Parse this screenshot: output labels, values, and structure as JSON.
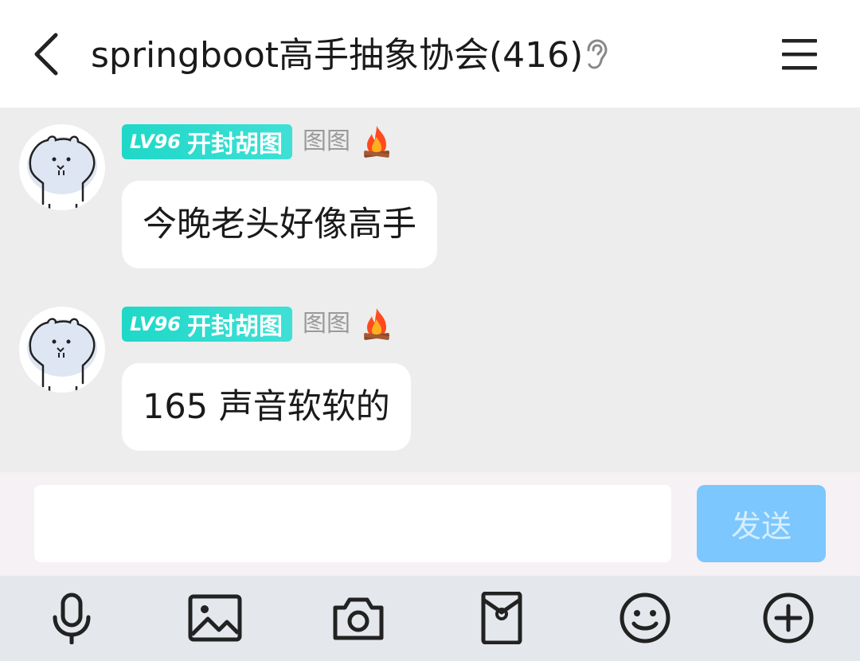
{
  "header": {
    "title": "springboot高手抽象协会(416)",
    "back_icon": "chevron-left-icon",
    "ear_icon": "ear-icon",
    "menu_icon": "hamburger-menu-icon"
  },
  "messages": [
    {
      "level": "LV96",
      "title": "开封胡图",
      "nickname": "图图",
      "emoji": "🔥",
      "text": "今晚老头好像高手"
    },
    {
      "level": "LV96",
      "title": "开封胡图",
      "nickname": "图图",
      "emoji": "🔥",
      "text": "165 声音软软的"
    }
  ],
  "input": {
    "value": "",
    "placeholder": "",
    "send_label": "发送"
  },
  "toolbar": {
    "icons": [
      "microphone-icon",
      "image-icon",
      "camera-icon",
      "red-packet-icon",
      "emoji-icon",
      "plus-icon"
    ]
  },
  "colors": {
    "badge": "#1fd8c8",
    "send_button": "#7cc7fd",
    "chat_background": "#ededed",
    "toolbar_background": "#e4e8ec"
  }
}
